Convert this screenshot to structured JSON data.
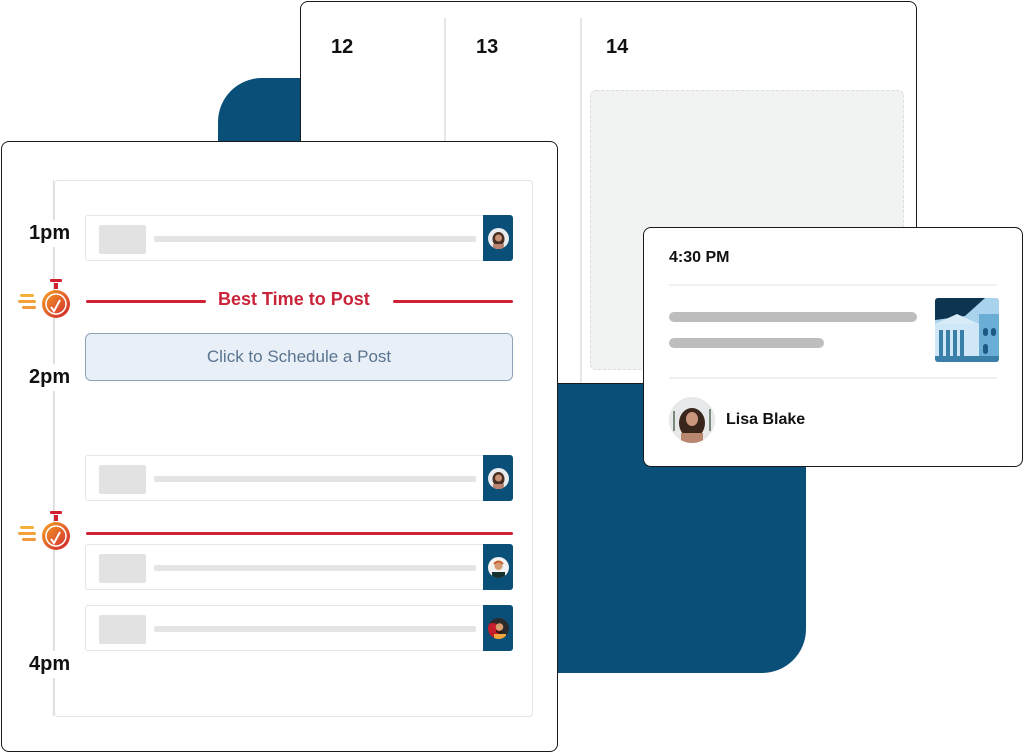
{
  "colors": {
    "brand_blue": "#0a4f78",
    "best_time_red": "#cf2034",
    "schedule_button_bg": "#e8eff6",
    "schedule_button_text": "#5a7490"
  },
  "calendar": {
    "days": [
      "12",
      "13",
      "14"
    ]
  },
  "schedule": {
    "time_labels": [
      "1pm",
      "2pm",
      "4pm"
    ],
    "best_time_label": "Best Time to Post",
    "schedule_button_label": "Click to Schedule a Post",
    "stopwatch_icon": "stopwatch-check-icon",
    "posts": [
      {
        "avatar": "woman-curly-hair-avatar"
      },
      {
        "avatar": "woman-curly-hair-avatar"
      },
      {
        "avatar": "man-headphones-avatar"
      },
      {
        "avatar": "man-red-background-avatar"
      }
    ]
  },
  "post_preview": {
    "time": "4:30 PM",
    "image_icon": "building-illustration-icon",
    "author_name": "Lisa Blake",
    "author_avatar": "woman-curly-hair-avatar"
  }
}
